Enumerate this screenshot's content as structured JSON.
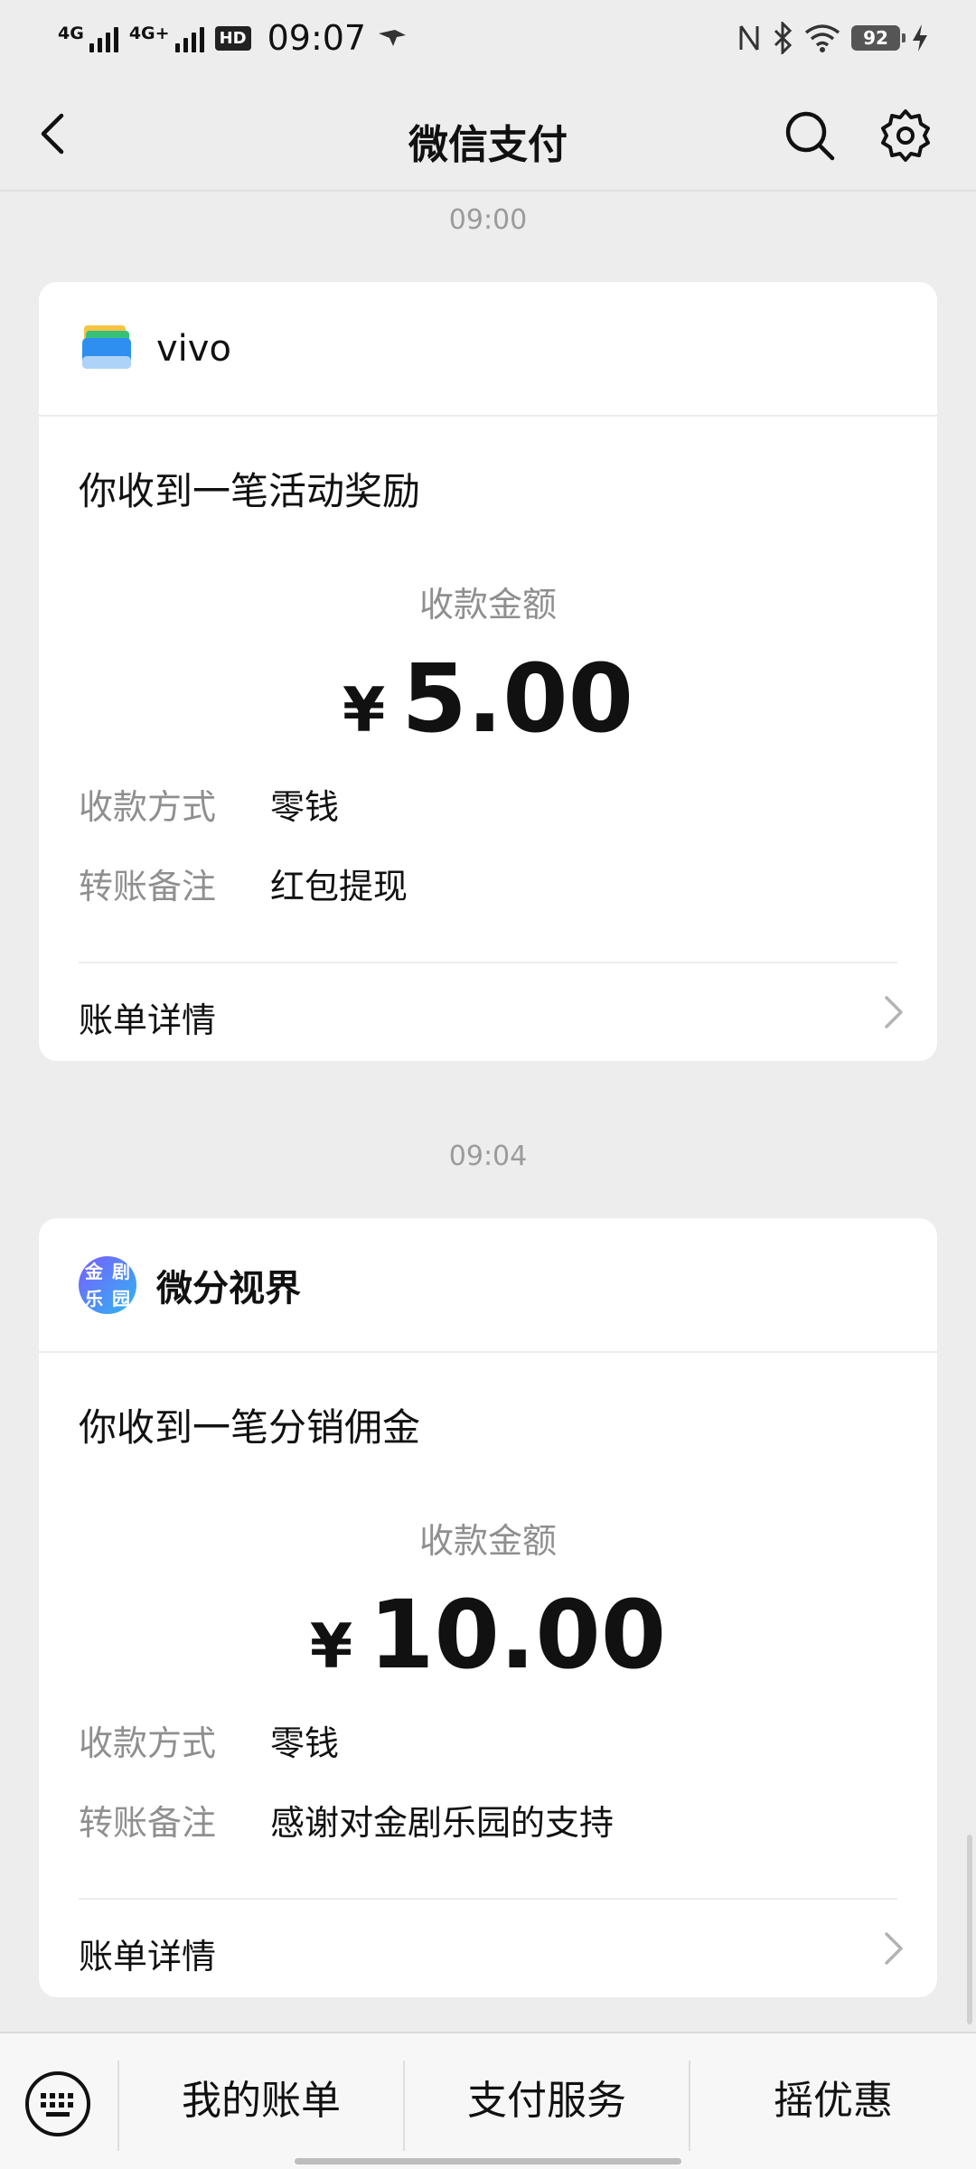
{
  "status_bar": {
    "net1": "4G",
    "net2": "4G+",
    "hd": "HD",
    "time": "09:07",
    "battery": "92"
  },
  "nav": {
    "title": "微信支付"
  },
  "messages": [
    {
      "timestamp": "09:00",
      "merchant": "vivo",
      "title": "你收到一笔活动奖励",
      "amount_label": "收款金额",
      "currency": "¥",
      "amount": "5.00",
      "rows": [
        {
          "key": "收款方式",
          "value": "零钱"
        },
        {
          "key": "转账备注",
          "value": "红包提现"
        }
      ],
      "detail_label": "账单详情"
    },
    {
      "timestamp": "09:04",
      "merchant": "微分视界",
      "icon_text": [
        "金",
        "剧",
        "乐",
        "园"
      ],
      "title": "你收到一笔分销佣金",
      "amount_label": "收款金额",
      "currency": "¥",
      "amount": "10.00",
      "rows": [
        {
          "key": "收款方式",
          "value": "零钱"
        },
        {
          "key": "转账备注",
          "value": "感谢对金剧乐园的支持"
        }
      ],
      "detail_label": "账单详情"
    }
  ],
  "bottom_menu": {
    "items": [
      "我的账单",
      "支付服务",
      "摇优惠"
    ]
  },
  "icons": {
    "back": "back-arrow-icon",
    "search": "search-icon",
    "settings": "gear-icon",
    "keyboard": "keyboard-icon",
    "chevron": "chevron-right-icon"
  },
  "colors": {
    "background": "#ededed",
    "card": "#ffffff",
    "muted_text": "#8f8f8f"
  }
}
